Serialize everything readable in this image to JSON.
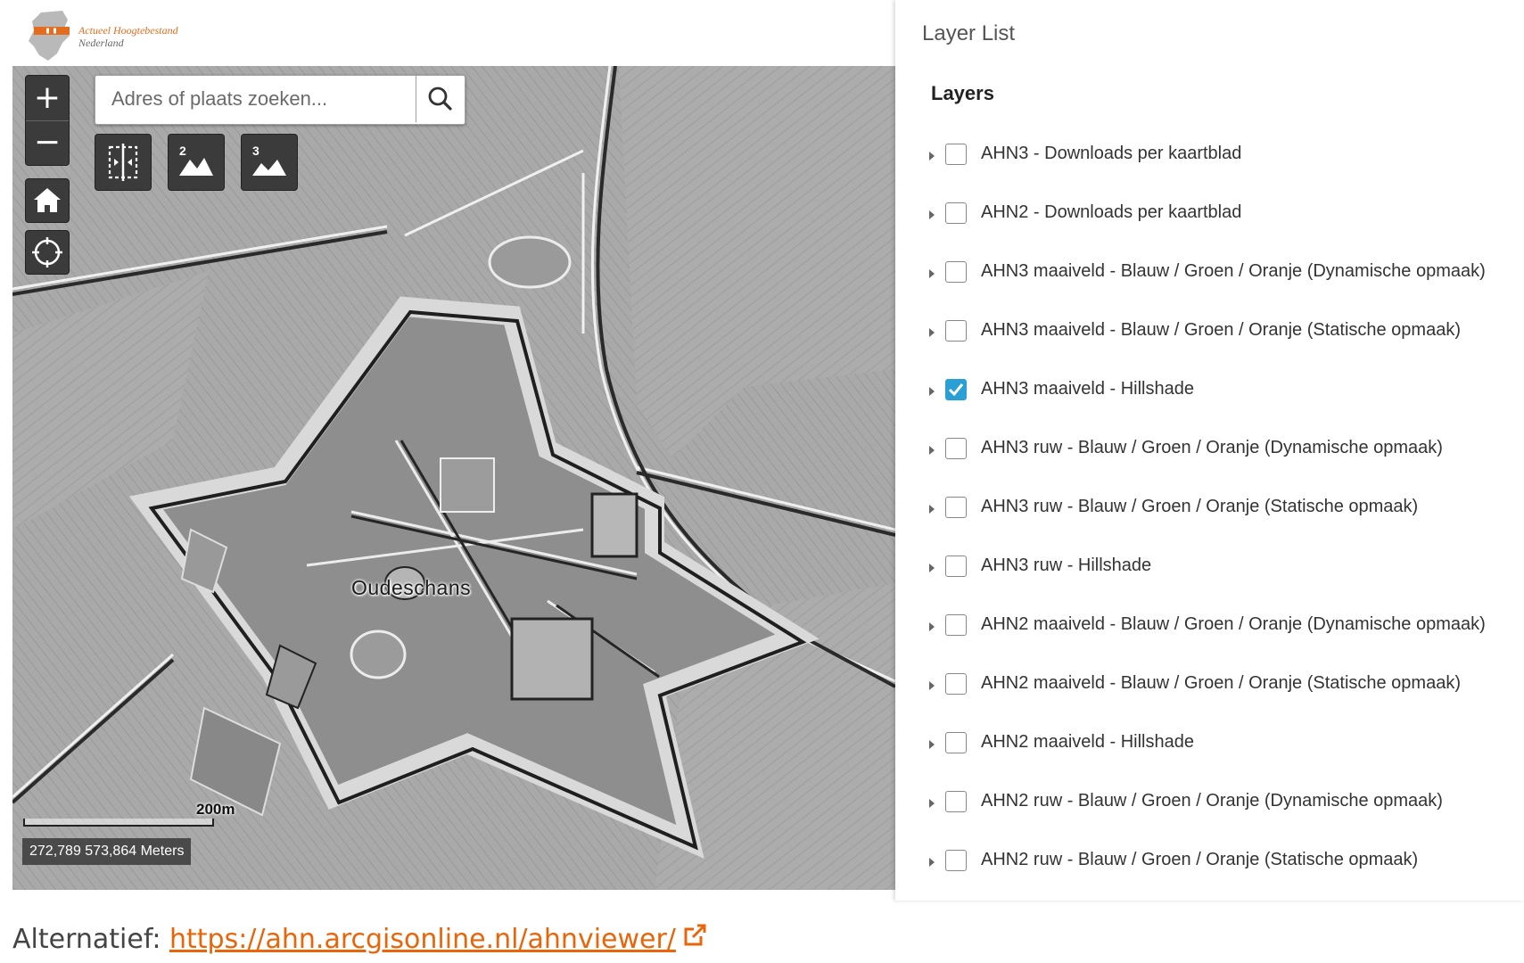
{
  "logo": {
    "title": "Actueel Hoogtebestand",
    "subtitle": "Nederland",
    "accent": "#e46c1e"
  },
  "map": {
    "zoom_in": "+",
    "zoom_out": "−",
    "search_placeholder": "Adres of plaats zoeken...",
    "tools": [
      {
        "icon": "split-view-icon",
        "label": ""
      },
      {
        "icon": "elevation-2-icon",
        "label": "2"
      },
      {
        "icon": "elevation-3-icon",
        "label": "3"
      }
    ],
    "place_label": "Oudeschans",
    "scale_label": "200m",
    "coordinates": "272,789 573,864 Meters"
  },
  "layer_list": {
    "title": "Layer List",
    "section": "Layers",
    "checked_color": "#2a9fd6",
    "layers": [
      {
        "label": "AHN3 - Downloads per kaartblad",
        "checked": false
      },
      {
        "label": "AHN2 - Downloads per kaartblad",
        "checked": false
      },
      {
        "label": "AHN3 maaiveld - Blauw / Groen / Oranje (Dynamische opmaak)",
        "checked": false
      },
      {
        "label": "AHN3 maaiveld - Blauw / Groen / Oranje (Statische opmaak)",
        "checked": false
      },
      {
        "label": "AHN3 maaiveld - Hillshade",
        "checked": true
      },
      {
        "label": "AHN3 ruw - Blauw / Groen / Oranje (Dynamische opmaak)",
        "checked": false
      },
      {
        "label": "AHN3 ruw - Blauw / Groen / Oranje (Statische opmaak)",
        "checked": false
      },
      {
        "label": "AHN3 ruw - Hillshade",
        "checked": false
      },
      {
        "label": "AHN2 maaiveld - Blauw / Groen / Oranje (Dynamische opmaak)",
        "checked": false
      },
      {
        "label": "AHN2 maaiveld - Blauw / Groen / Oranje (Statische opmaak)",
        "checked": false
      },
      {
        "label": "AHN2 maaiveld - Hillshade",
        "checked": false
      },
      {
        "label": "AHN2 ruw - Blauw / Groen / Oranje (Dynamische opmaak)",
        "checked": false
      },
      {
        "label": "AHN2 ruw - Blauw / Groen / Oranje (Statische opmaak)",
        "checked": false
      }
    ]
  },
  "footer": {
    "prefix": "Alternatief:",
    "link_text": "https://ahn.arcgisonline.nl/ahnviewer/",
    "link_color": "#e8650a"
  }
}
